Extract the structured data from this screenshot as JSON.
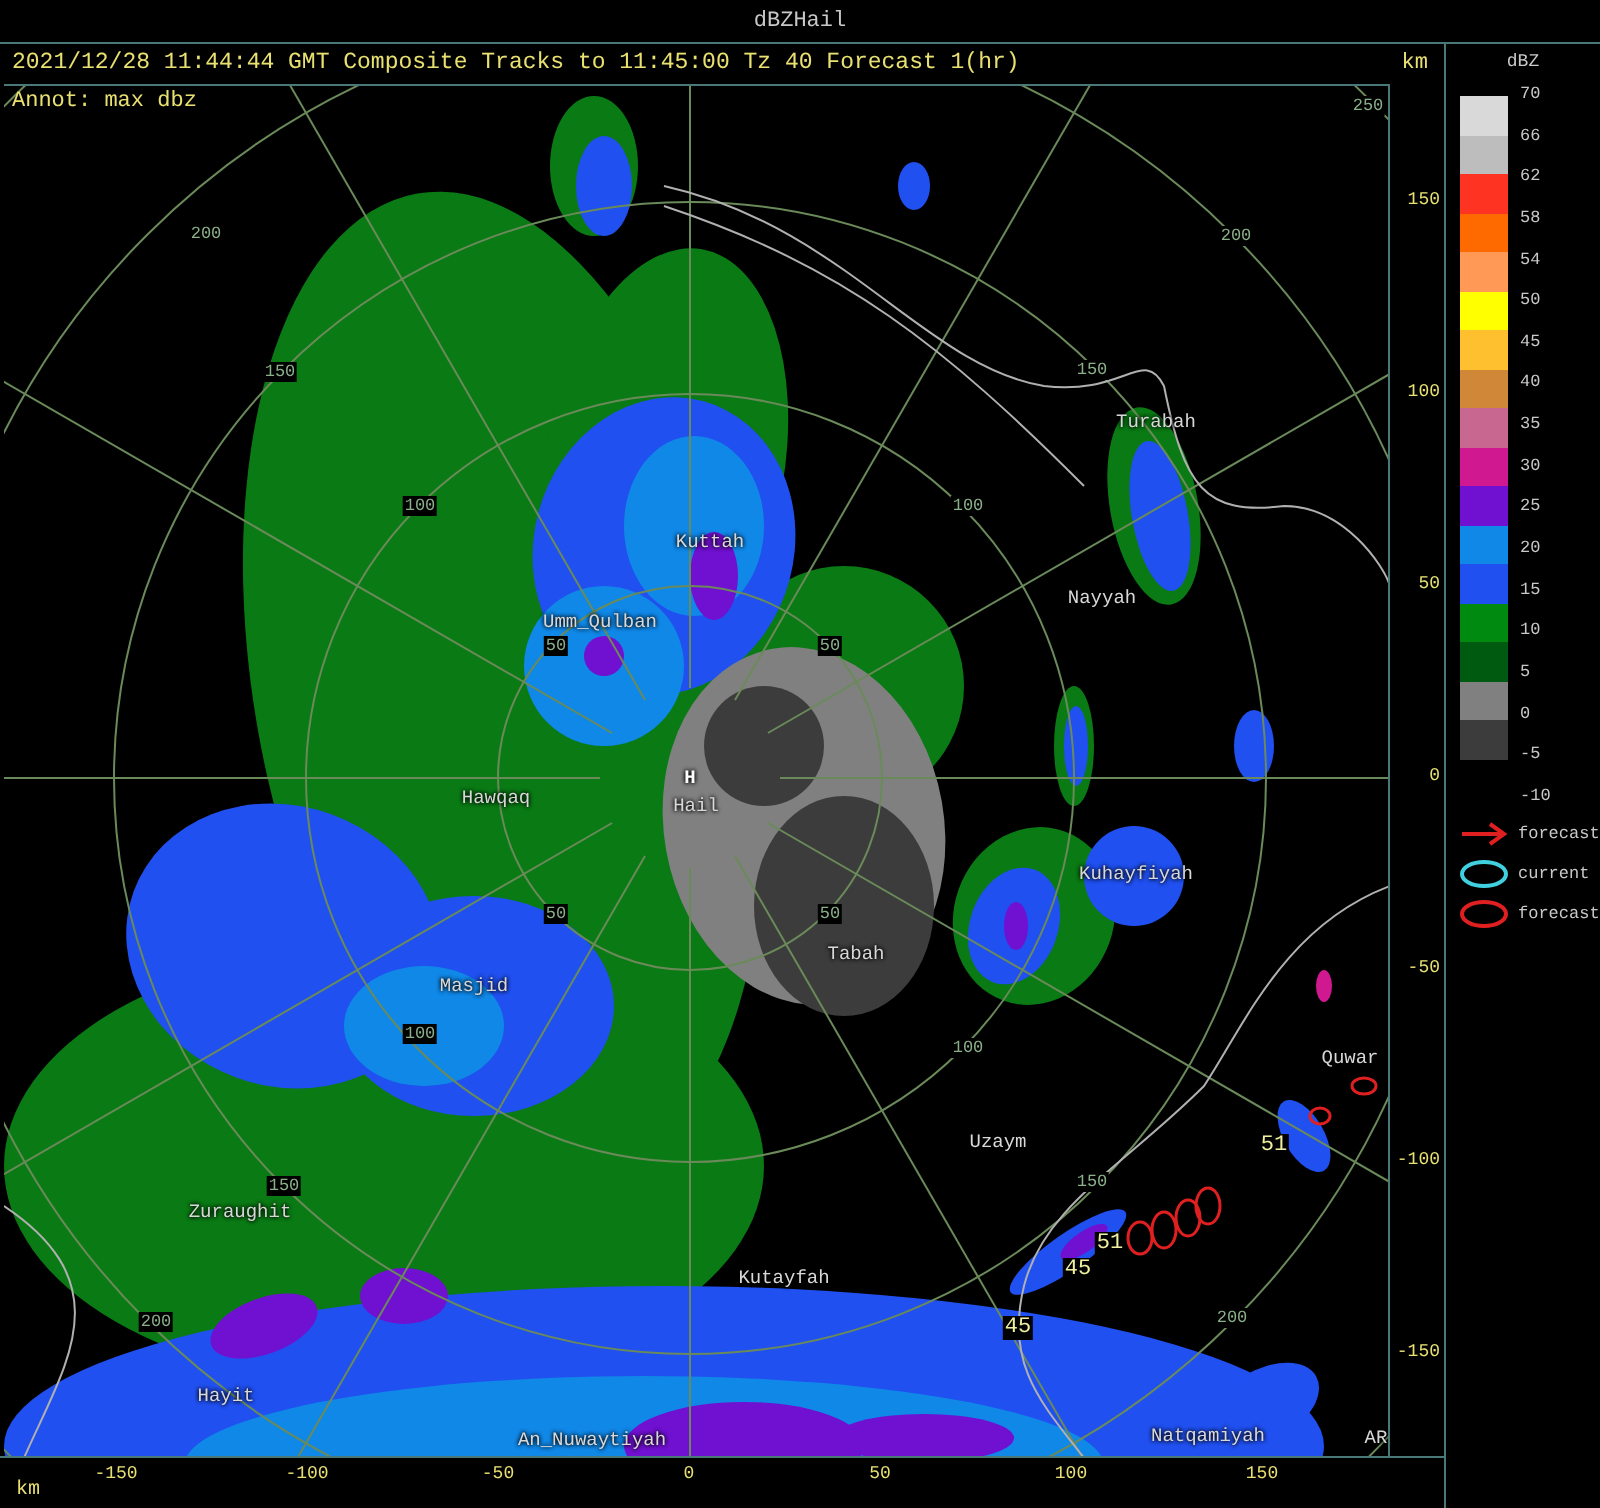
{
  "window": {
    "title": "dBZHail"
  },
  "header": {
    "info": "2021/12/28 11:44:44 GMT Composite Tracks to 11:45:00 Tz 40 Forecast 1(hr)",
    "unit": "km",
    "annotation": "Annot: max dbz"
  },
  "map": {
    "places": [
      {
        "kind": "town",
        "name": "Kuttah"
      },
      {
        "kind": "town",
        "name": "Umm_Qulban"
      },
      {
        "kind": "town",
        "name": "Nayyah"
      },
      {
        "kind": "town",
        "name": "Turabah"
      },
      {
        "kind": "town",
        "name": "Hawqaq"
      },
      {
        "kind": "site",
        "name": "H"
      },
      {
        "kind": "town",
        "name": "Hail"
      },
      {
        "kind": "town",
        "name": "Kuhayfiyah"
      },
      {
        "kind": "town",
        "name": "Tabah"
      },
      {
        "kind": "town",
        "name": "Masjid"
      },
      {
        "kind": "town",
        "name": "Quwar"
      },
      {
        "kind": "town",
        "name": "Uzaym"
      },
      {
        "kind": "town",
        "name": "Zuraughit"
      },
      {
        "kind": "town",
        "name": "Kutayfah"
      },
      {
        "kind": "town",
        "name": "Hayit"
      },
      {
        "kind": "town",
        "name": "An_Nuwaytiyah"
      },
      {
        "kind": "town",
        "name": "Natqamiyah"
      },
      {
        "kind": "town",
        "name": "AR"
      }
    ],
    "range_labels": [
      "200",
      "150",
      "100",
      "50",
      "50",
      "100",
      "150",
      "200",
      "250",
      "50",
      "100",
      "150",
      "200",
      "50",
      "100",
      "150",
      "200"
    ],
    "storm_tracks": [
      {
        "label": "51"
      },
      {
        "label": "51"
      },
      {
        "label": "45"
      },
      {
        "label": "45"
      }
    ]
  },
  "y_axis": {
    "ticks": [
      "150",
      "100",
      "50",
      "0",
      "-50",
      "-100",
      "-150"
    ]
  },
  "x_axis": {
    "unit": "km",
    "ticks": [
      "-150",
      "-100",
      "-50",
      "0",
      "50",
      "100",
      "150"
    ]
  },
  "legend": {
    "title": "dBZ",
    "bins": [
      {
        "color": "#d9d9d9"
      },
      {
        "color": "#bdbdbd"
      },
      {
        "color": "#ff3322"
      },
      {
        "color": "#ff6a00"
      },
      {
        "color": "#ff9955"
      },
      {
        "color": "#ffff00"
      },
      {
        "color": "#ffc030"
      },
      {
        "color": "#d08838"
      },
      {
        "color": "#c86890"
      },
      {
        "color": "#d01890"
      },
      {
        "color": "#7010d0"
      },
      {
        "color": "#1088e8"
      },
      {
        "color": "#2050f0"
      },
      {
        "color": "#008a10"
      },
      {
        "color": "#005a10"
      },
      {
        "color": "#808080"
      },
      {
        "color": "#3c3c3c"
      }
    ],
    "labels": [
      "70",
      "66",
      "62",
      "58",
      "54",
      "50",
      "45",
      "40",
      "35",
      "30",
      "25",
      "20",
      "15",
      "10",
      "5",
      "0",
      "-5",
      "-10"
    ],
    "symbols": [
      {
        "kind": "arrow",
        "color": "#e02020",
        "label": "forecast"
      },
      {
        "kind": "ellipse",
        "color": "#40d0e0",
        "label": "current"
      },
      {
        "kind": "ellipse",
        "color": "#e02020",
        "label": "forecast"
      }
    ]
  }
}
